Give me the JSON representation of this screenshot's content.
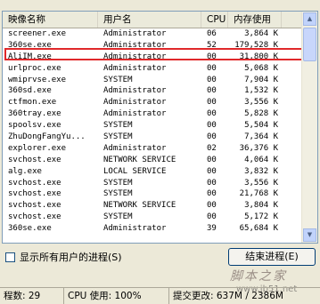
{
  "columns": [
    "映像名称",
    "用户名",
    "CPU",
    "内存使用"
  ],
  "processes": [
    {
      "name": "screener.exe",
      "user": "Administrator",
      "cpu": "06",
      "mem": "3,864 K"
    },
    {
      "name": "360se.exe",
      "user": "Administrator",
      "cpu": "52",
      "mem": "179,528 K"
    },
    {
      "name": "AliIM.exe",
      "user": "Administrator",
      "cpu": "00",
      "mem": "31,800 K"
    },
    {
      "name": "urlproc.exe",
      "user": "Administrator",
      "cpu": "00",
      "mem": "5,068 K"
    },
    {
      "name": "wmiprvse.exe",
      "user": "SYSTEM",
      "cpu": "00",
      "mem": "7,904 K"
    },
    {
      "name": "360sd.exe",
      "user": "Administrator",
      "cpu": "00",
      "mem": "1,532 K"
    },
    {
      "name": "ctfmon.exe",
      "user": "Administrator",
      "cpu": "00",
      "mem": "3,556 K"
    },
    {
      "name": "360tray.exe",
      "user": "Administrator",
      "cpu": "00",
      "mem": "5,828 K"
    },
    {
      "name": "spoolsv.exe",
      "user": "SYSTEM",
      "cpu": "00",
      "mem": "5,504 K"
    },
    {
      "name": "ZhuDongFangYu...",
      "user": "SYSTEM",
      "cpu": "00",
      "mem": "7,364 K"
    },
    {
      "name": "explorer.exe",
      "user": "Administrator",
      "cpu": "02",
      "mem": "36,376 K"
    },
    {
      "name": "svchost.exe",
      "user": "NETWORK SERVICE",
      "cpu": "00",
      "mem": "4,064 K"
    },
    {
      "name": "alg.exe",
      "user": "LOCAL SERVICE",
      "cpu": "00",
      "mem": "3,832 K"
    },
    {
      "name": "svchost.exe",
      "user": "SYSTEM",
      "cpu": "00",
      "mem": "3,556 K"
    },
    {
      "name": "svchost.exe",
      "user": "SYSTEM",
      "cpu": "00",
      "mem": "21,768 K"
    },
    {
      "name": "svchost.exe",
      "user": "NETWORK SERVICE",
      "cpu": "00",
      "mem": "3,804 K"
    },
    {
      "name": "svchost.exe",
      "user": "SYSTEM",
      "cpu": "00",
      "mem": "5,172 K"
    },
    {
      "name": "360se.exe",
      "user": "Administrator",
      "cpu": "39",
      "mem": "65,684 K"
    }
  ],
  "show_all_users_label": "显示所有用户的进程(S)",
  "end_process_label": "结束进程(E)",
  "watermark": "脚本之家",
  "watermark_url": "www.jb51.net",
  "status": {
    "process_count": "程数: 29",
    "cpu_usage": "CPU 使用: 100%",
    "commit": "提交更改: 637M / 2386M"
  },
  "colors": {
    "highlight_border": "#e0282a",
    "list_border": "#7f9db9"
  }
}
